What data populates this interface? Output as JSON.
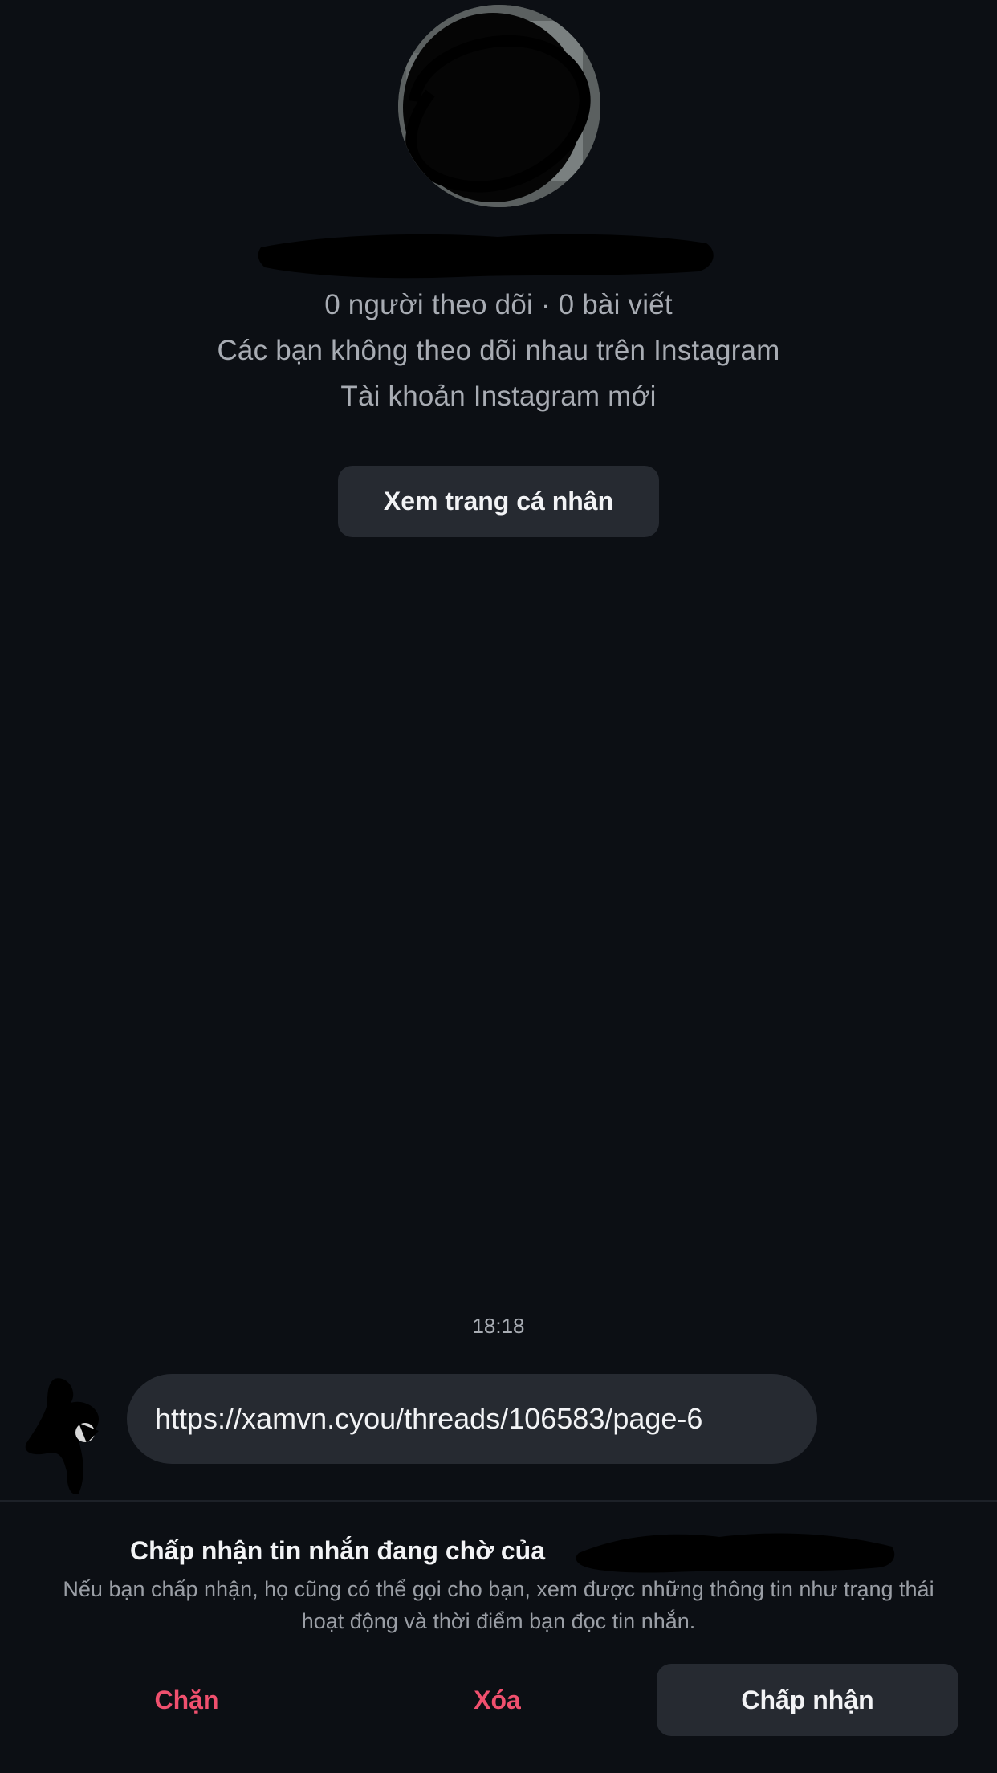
{
  "profile": {
    "stats": "0 người theo dõi · 0 bài viết",
    "mutual_status": "Các bạn không theo dõi nhau trên Instagram",
    "account_note": "Tài khoản Instagram mới",
    "view_profile_label": "Xem trang cá nhân"
  },
  "conversation": {
    "timestamp": "18:18",
    "messages": [
      {
        "text": "https://xamvn.cyou/threads/106583/page-6"
      }
    ]
  },
  "request_panel": {
    "title": "Chấp nhận tin nhắn đang chờ của",
    "description": "Nếu bạn chấp nhận, họ cũng có thể gọi cho bạn, xem được những thông tin như trạng thái hoạt động và thời điểm bạn đọc tin nhắn.",
    "block_label": "Chặn",
    "delete_label": "Xóa",
    "accept_label": "Chấp nhận"
  },
  "colors": {
    "background": "#0c0f14",
    "surface": "#262a31",
    "primary_text": "#f2f3f5",
    "secondary_text": "#a8acb3",
    "destructive": "#f0506e"
  }
}
